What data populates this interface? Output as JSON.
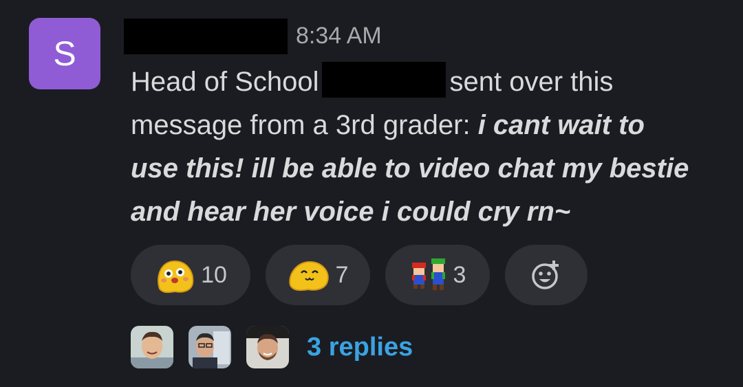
{
  "sender": {
    "avatar_initial": "S",
    "avatar_color": "#8f5cd6"
  },
  "message": {
    "timestamp": "8:34 AM",
    "text_part1": "Head of School",
    "text_part2": "sent over this",
    "text_part3": "message from a 3rd grader:",
    "quote_part1": "i cant wait to",
    "quote_part2": "use this! ill be able to video chat my bestie",
    "quote_part3": "and hear her voice i could cry rn~"
  },
  "reactions": [
    {
      "icon": "blushing-blob-emoji",
      "count": "10"
    },
    {
      "icon": "happy-blob-emoji",
      "count": "7"
    },
    {
      "icon": "mario-luigi-emoji",
      "count": "3"
    },
    {
      "icon": "add-reaction-icon",
      "count": ""
    }
  ],
  "thread": {
    "reply_count_label": "3 replies",
    "link_color": "#3aa3e3"
  }
}
